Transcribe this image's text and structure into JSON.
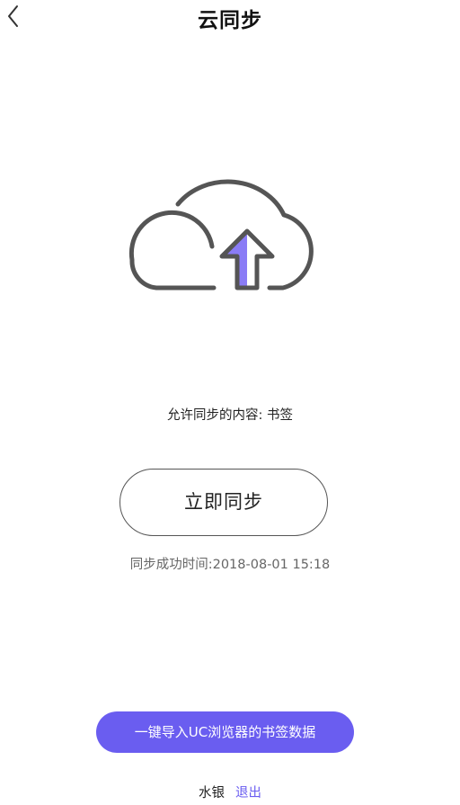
{
  "header": {
    "title": "云同步",
    "back_icon": "chevron-left-icon"
  },
  "illustration": {
    "icon": "cloud-upload-icon",
    "accent_color": "#8a7cf6",
    "stroke_color": "#555555"
  },
  "sync": {
    "allowed_content": "允许同步的内容: 书签",
    "button_label": "立即同步",
    "last_success": "同步成功时间:2018-08-01 15:18"
  },
  "import": {
    "button_label": "一键导入UC浏览器的书签数据",
    "button_color": "#6a5df0"
  },
  "account": {
    "username": "水银",
    "logout_label": "退出",
    "logout_color": "#6a5df0"
  }
}
